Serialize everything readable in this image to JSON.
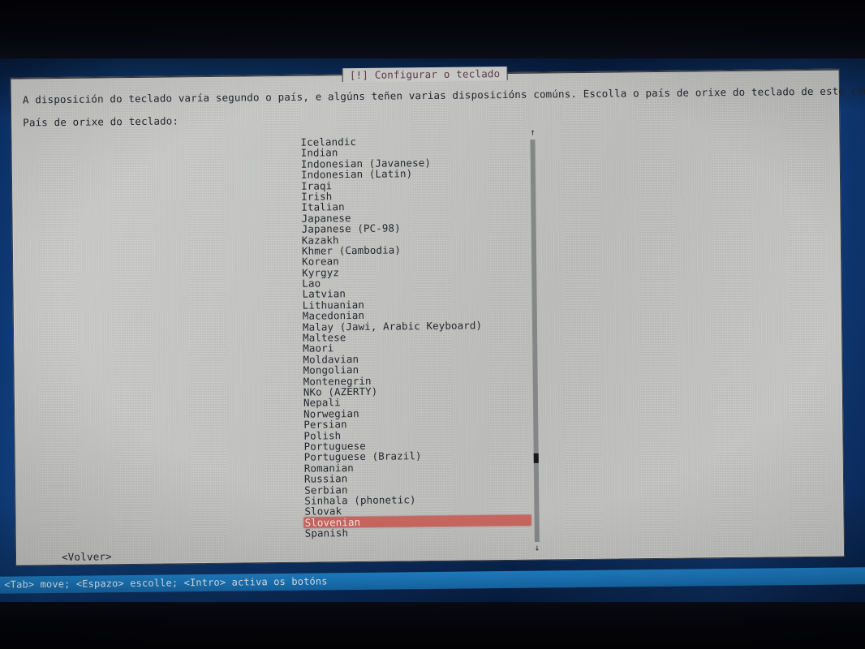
{
  "screen": {
    "background_color": "#0f3d7d",
    "panel_description": "debian-installer newt dialog on blue background"
  },
  "dialog": {
    "title": "[!] Configurar o teclado",
    "title_color": "#5c3b4a",
    "background_color": "#c8c9c6",
    "intro_text": "A disposición do teclado varía segundo o país, e algúns teñen varias disposicións comúns. Escolla o país de orixe do teclado de este computador.",
    "prompt_label": "País de orixe do teclado:"
  },
  "list": {
    "selected_index": 35,
    "selected_value": "Spanish",
    "highlight_color": "#c7655f",
    "highlight_text_color": "#f2e2e0",
    "items": [
      "Icelandic",
      "Indian",
      "Indonesian (Javanese)",
      "Indonesian (Latin)",
      "Iraqi",
      "Irish",
      "Italian",
      "Japanese",
      "Japanese (PC-98)",
      "Kazakh",
      "Khmer (Cambodia)",
      "Korean",
      "Kyrgyz",
      "Lao",
      "Latvian",
      "Lithuanian",
      "Macedonian",
      "Malay (Jawi, Arabic Keyboard)",
      "Maltese",
      "Maori",
      "Moldavian",
      "Mongolian",
      "Montenegrin",
      "NKo (AZERTY)",
      "Nepali",
      "Norwegian",
      "Persian",
      "Polish",
      "Portuguese",
      "Portuguese (Brazil)",
      "Romanian",
      "Russian",
      "Serbian",
      "Sinhala (phonetic)",
      "Slovak",
      "Slovenian",
      "Spanish"
    ]
  },
  "scrollbar": {
    "up_arrow_glyph": "↑",
    "down_arrow_glyph": "↓",
    "thumb_color": "#16171c"
  },
  "buttons": {
    "back_label": "<Volver>"
  },
  "statusbar": {
    "text": "<Tab> move; <Espazo> escolle; <Intro> activa os botóns",
    "background_color": "#1b76ba",
    "text_color": "#dfeaf3"
  }
}
